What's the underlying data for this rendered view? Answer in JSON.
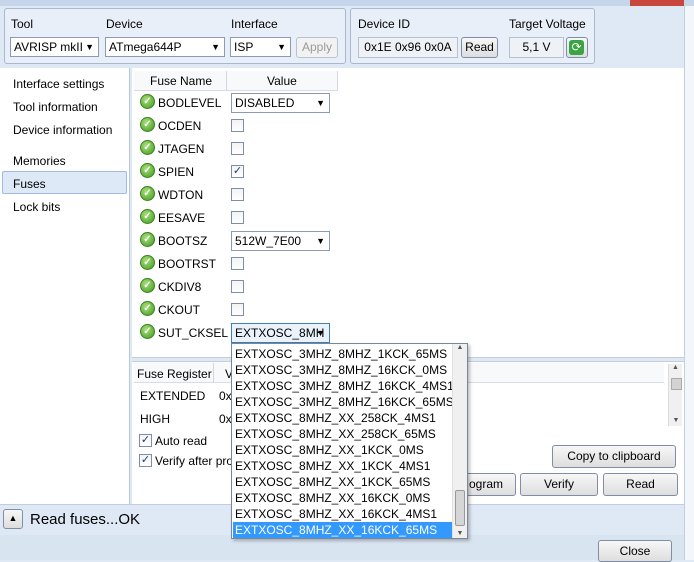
{
  "tool_group": {
    "tool_label": "Tool",
    "tool_value": "AVRISP mkII",
    "device_label": "Device",
    "device_value": "ATmega644P",
    "interface_label": "Interface",
    "interface_value": "ISP",
    "apply_label": "Apply"
  },
  "device_group": {
    "device_id_label": "Device ID",
    "device_id_value": "0x1E 0x96 0x0A",
    "read_label": "Read",
    "voltage_label": "Target Voltage",
    "voltage_value": "5,1 V"
  },
  "sidebar": {
    "items": [
      "Interface settings",
      "Tool information",
      "Device information",
      "Memories",
      "Fuses",
      "Lock bits"
    ],
    "selected": "Fuses"
  },
  "fuse_table": {
    "col_name": "Fuse Name",
    "col_value": "Value",
    "rows": [
      {
        "name": "BODLEVEL",
        "type": "combo",
        "value": "DISABLED"
      },
      {
        "name": "OCDEN",
        "type": "check",
        "checked": false
      },
      {
        "name": "JTAGEN",
        "type": "check",
        "checked": false
      },
      {
        "name": "SPIEN",
        "type": "check",
        "checked": true
      },
      {
        "name": "WDTON",
        "type": "check",
        "checked": false
      },
      {
        "name": "EESAVE",
        "type": "check",
        "checked": false
      },
      {
        "name": "BOOTSZ",
        "type": "combo",
        "value": "512W_7E00"
      },
      {
        "name": "BOOTRST",
        "type": "check",
        "checked": false
      },
      {
        "name": "CKDIV8",
        "type": "check",
        "checked": false
      },
      {
        "name": "CKOUT",
        "type": "check",
        "checked": false
      },
      {
        "name": "SUT_CKSEL",
        "type": "combo",
        "value": "EXTXOSC_8MH"
      }
    ]
  },
  "register_table": {
    "col_register": "Fuse Register",
    "col_value": "V",
    "rows": [
      {
        "name": "EXTENDED",
        "value": "0x"
      },
      {
        "name": "HIGH",
        "value": "0x"
      }
    ]
  },
  "options": {
    "auto_read": "Auto read",
    "auto_read_checked": true,
    "verify": "Verify after pro",
    "verify_checked": true
  },
  "buttons": {
    "copy": "Copy to clipboard",
    "program": "ogram",
    "verify": "Verify",
    "read": "Read",
    "close": "Close"
  },
  "dropdown": {
    "items": [
      "EXTXOSC_3MHZ_8MHZ_1KCK_65MS",
      "EXTXOSC_3MHZ_8MHZ_16KCK_0MS",
      "EXTXOSC_3MHZ_8MHZ_16KCK_4MS1",
      "EXTXOSC_3MHZ_8MHZ_16KCK_65MS",
      "EXTXOSC_8MHZ_XX_258CK_4MS1",
      "EXTXOSC_8MHZ_XX_258CK_65MS",
      "EXTXOSC_8MHZ_XX_1KCK_0MS",
      "EXTXOSC_8MHZ_XX_1KCK_4MS1",
      "EXTXOSC_8MHZ_XX_1KCK_65MS",
      "EXTXOSC_8MHZ_XX_16KCK_0MS",
      "EXTXOSC_8MHZ_XX_16KCK_4MS1",
      "EXTXOSC_8MHZ_XX_16KCK_65MS"
    ],
    "selected_index": 11
  },
  "status": {
    "text": "Read fuses...OK"
  },
  "colors": {
    "selection": "#3399ff",
    "window_bg": "#dfe9f5"
  }
}
